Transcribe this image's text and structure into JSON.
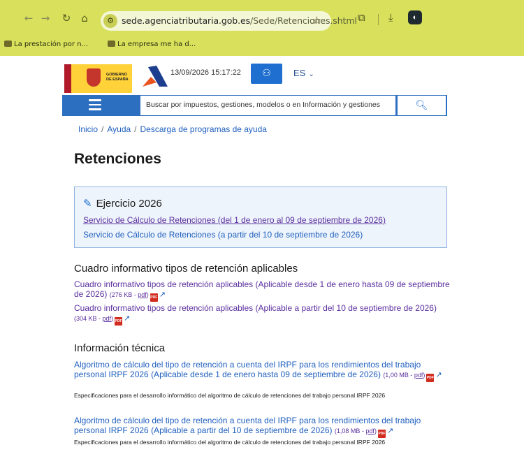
{
  "browser": {
    "url_host": "sede.agenciatributaria.gob.es",
    "url_path": "/Sede/Retenciones.shtml",
    "bookmarks": [
      "La prestación por n...",
      "La empresa me ha d..."
    ]
  },
  "header": {
    "gov_logo_text": "GOBIERNO DE ESPAÑA",
    "datetime": "13/09/2026 15:17:22",
    "lang": "ES"
  },
  "search": {
    "placeholder": "Buscar por impuestos, gestiones, modelos o en Información y gestiones"
  },
  "breadcrumb": [
    "Inicio",
    "Ayuda",
    "Descarga de programas de ayuda"
  ],
  "title": "Retenciones",
  "ejercicio": {
    "title": "Ejercicio 2026",
    "links": [
      "Servicio de Cálculo de Retenciones (del 1 de enero al 09 de septiembre de 2026)",
      "Servicio de Cálculo de Retenciones (a partir del 10 de septiembre de 2026)"
    ]
  },
  "cuadro": {
    "heading": "Cuadro informativo tipos de retención aplicables",
    "items": [
      {
        "text": "Cuadro informativo tipos de retención aplicables (Aplicable desde 1 de enero hasta 09 de septiembre de 2026)",
        "size": "(276 KB - ",
        "fmt": "pdf",
        "close": ")"
      },
      {
        "text": "Cuadro informativo tipos de retención aplicables (Aplicable a partir del 10 de septiembre de 2026)",
        "size": "(304 KB - ",
        "fmt": "pdf",
        "close": ")"
      }
    ]
  },
  "tecnica": {
    "heading": "Información técnica",
    "items": [
      {
        "text": "Algoritmo de cálculo del tipo de retención a cuenta del IRPF para los rendimientos del trabajo personal IRPF 2026 (Aplicable desde 1 de enero hasta 09 de septiembre de 2026)",
        "size": "(1,00 MB - ",
        "fmt": "pdf",
        "close": ")",
        "spec": "Especificaciones para el desarrollo informático del algoritmo de cálculo de retenciones del trabajo personal IRPF 2026"
      },
      {
        "text": "Algoritmo de cálculo del tipo de retención a cuenta del IRPF para los rendimientos del trabajo personal IRPF 2026 (Aplicable a partir del 10 de septiembre de 2026)",
        "size": "(1,08 MB - ",
        "fmt": "pdf",
        "close": ")",
        "spec": "Especificaciones para el desarrollo informático del algoritmo de cálculo de retenciones del trabajo personal IRPF 2026"
      }
    ]
  },
  "icons": {
    "pdf_badge": "PDF"
  }
}
